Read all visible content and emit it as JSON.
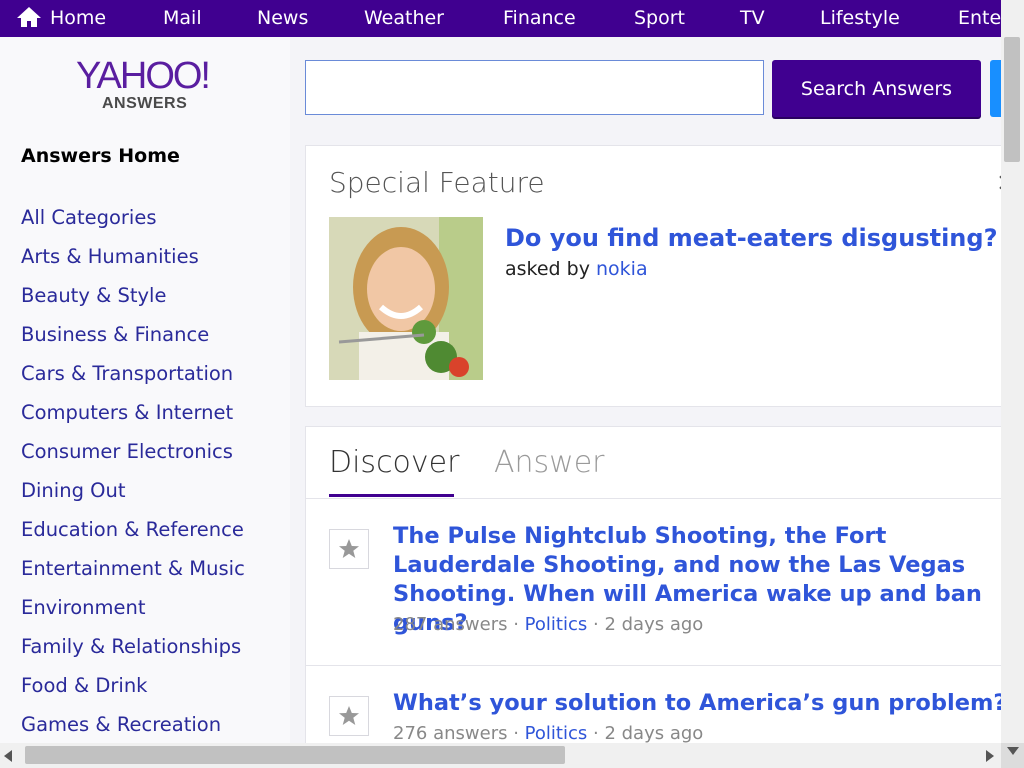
{
  "topnav": {
    "items": [
      "Home",
      "Mail",
      "News",
      "Weather",
      "Finance",
      "Sport",
      "TV",
      "Lifestyle",
      "Ente"
    ]
  },
  "logo": {
    "yahoo": "YAHOO!",
    "answers": "ANSWERS"
  },
  "sidebar": {
    "home": "Answers Home",
    "categories": [
      "All Categories",
      "Arts & Humanities",
      "Beauty & Style",
      "Business & Finance",
      "Cars & Transportation",
      "Computers & Internet",
      "Consumer Electronics",
      "Dining Out",
      "Education & Reference",
      "Entertainment & Music",
      "Environment",
      "Family & Relationships",
      "Food & Drink",
      "Games & Recreation"
    ]
  },
  "search": {
    "value": "",
    "button": "Search Answers"
  },
  "feature": {
    "title": "Special Feature",
    "close": "×",
    "question": "Do you find meat-eaters disgusting?",
    "asked_by": "asked by",
    "user": "nokia"
  },
  "tabs": {
    "discover": "Discover",
    "answer": "Answer"
  },
  "questions": [
    {
      "title": "The Pulse Nightclub Shooting, the Fort Lauderdale Shooting, and now the Las Vegas Shooting. When will America wake up and ban guns?",
      "answers": "287 answers",
      "sep": "·",
      "category": "Politics",
      "time": "2 days ago"
    },
    {
      "title": "What’s your solution to America’s gun problem?",
      "answers": "276 answers",
      "sep": "·",
      "category": "Politics",
      "time": "2 days ago"
    }
  ],
  "colors": {
    "brand": "#400090",
    "link": "#2f55d9",
    "category": "#2a2a9a"
  }
}
